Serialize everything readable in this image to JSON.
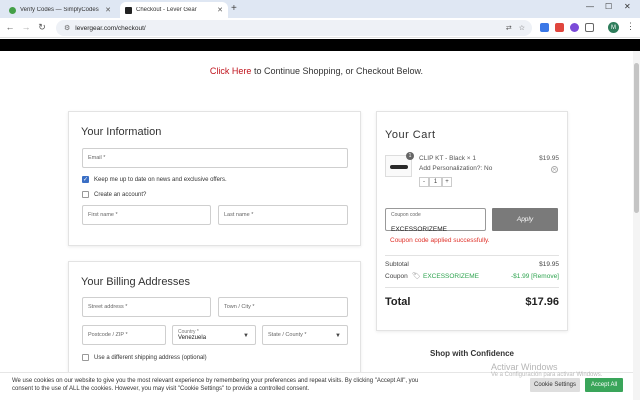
{
  "browser": {
    "tabs": [
      {
        "title": "Verify Codes — SimplyCodes",
        "favicon": "simplycodes-icon"
      },
      {
        "title": "Checkout - Lever Gear",
        "favicon": "lever-gear-icon"
      }
    ],
    "url": "levergear.com/checkout/",
    "profile_initial": "M"
  },
  "header": {
    "link_text": "Click Here",
    "continue_text": " to Continue Shopping, or Checkout Below."
  },
  "info": {
    "title": "Your Information",
    "email_placeholder": "Email *",
    "newsletter_label": "Keep me up to date on news and exclusive offers.",
    "newsletter_checked": true,
    "create_account_label": "Create an account?",
    "first_name_placeholder": "First name *",
    "last_name_placeholder": "Last name *"
  },
  "billing": {
    "title": "Your Billing Addresses",
    "street_placeholder": "Street address *",
    "city_placeholder": "Town / City *",
    "postcode_placeholder": "Postcode / ZIP *",
    "country_label": "Country *",
    "country_value": "Venezuela",
    "state_placeholder": "State / County *",
    "different_shipping_label": "Use a different shipping address (optional)"
  },
  "cart": {
    "title": "Your Cart",
    "item": {
      "quantity_badge": "1",
      "name": "CLIP KT - Black × 1",
      "option": "Add Personalization?: No",
      "price": "$19.95",
      "qty": "1",
      "minus": "-",
      "plus": "+"
    },
    "coupon_label": "Coupon code",
    "coupon_value": "EXCESSORIZEME",
    "apply_label": "Apply",
    "coupon_message": "Coupon code applied successfully.",
    "subtotal_label": "Subtotal",
    "subtotal_value": "$19.95",
    "coupon_row_label": "Coupon",
    "coupon_row_code": "EXCESSORIZEME",
    "discount_value": "-$1.99 [Remove]",
    "total_label": "Total",
    "total_value": "$17.96"
  },
  "shop_confidence": "Shop with Confidence",
  "watermark": {
    "title": "Activar Windows",
    "subtitle": "Ve a Configuración para activar Windows."
  },
  "cookie": {
    "text": "We use cookies on our website to give you the most relevant experience by remembering your preferences and repeat visits. By clicking \"Accept All\", you consent to the use of ALL the cookies. However, you may visit \"Cookie Settings\" to provide a controlled consent.",
    "settings_label": "Cookie Settings",
    "accept_label": "Accept All"
  },
  "colors": {
    "link_red": "#c0131c",
    "success_green": "#2ea44f",
    "error_red": "#e0322a",
    "accept_green": "#3aa55a",
    "apply_gray": "#7a7a7a"
  }
}
